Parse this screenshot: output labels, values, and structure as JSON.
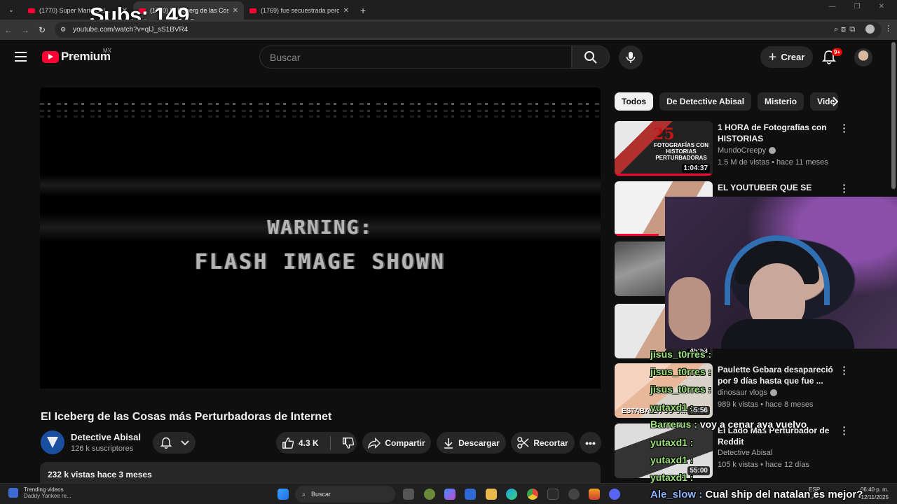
{
  "browser": {
    "tabs": [
      {
        "title": "(1770) Super Mario Gal..."
      },
      {
        "title": "(1770) El Iceberg de las Cosas má..."
      },
      {
        "title": "(1769) fue secuestrada pero la..."
      }
    ],
    "url": "youtube.com/watch?v=qlJ_sS1BVR4"
  },
  "stream_overlay": {
    "subs": "Subs: 149,"
  },
  "youtube": {
    "logo": "Premium",
    "region": "MX",
    "search_placeholder": "Buscar",
    "create_label": "Crear",
    "notif_badge": "9+"
  },
  "video": {
    "warning_line1": "WARNING:",
    "warning_line2": "FLASH IMAGE SHOWN",
    "title": "El Iceberg de las Cosas más Perturbadoras de Internet",
    "channel": "Detective Abisal",
    "subscribers": "126 k suscriptores",
    "likes": "4.3 K",
    "share": "Compartir",
    "download": "Descargar",
    "clip": "Recortar",
    "views_line": "232 k vistas  hace 3 meses"
  },
  "chips": [
    "Todos",
    "De Detective Abisal",
    "Misterio",
    "Vide"
  ],
  "recommendations": [
    {
      "title": "1 HORA de Fotografías con HISTORIAS PERTURBADORAS...",
      "channel": "MundoCreepy",
      "verified": true,
      "meta": "1.5 M de vistas • hace 11 meses",
      "duration": "1:04:37",
      "thumb_text": "25",
      "thumb_caption": "FOTOGRAFÍAS CON HISTORIAS PERTURBADORAS",
      "progress": 1.0
    },
    {
      "title": "EL YOUTUBER QUE SE",
      "channel": "",
      "verified": false,
      "meta": "",
      "duration": "",
      "progress": 0.45
    },
    {
      "title": "",
      "channel": "",
      "verified": false,
      "meta": "",
      "duration": "",
      "progress": 0
    },
    {
      "title": "",
      "channel": "",
      "verified": false,
      "meta": "",
      "duration": "45:53",
      "progress": 0
    },
    {
      "title": "Paulette Gebara desapareció por 9 días hasta que fue ...",
      "channel": "dinosaur vlogs",
      "verified": true,
      "meta": "989 k vistas • hace 8 meses",
      "duration": "55:56",
      "thumb_caption": "ESTABA EN SU C...",
      "progress": 0
    },
    {
      "title": "El Lado Más Perturbador de Reddit",
      "channel": "Detective Abisal",
      "verified": false,
      "meta": "105 k vistas • hace 12 días",
      "duration": "55:00",
      "progress": 0
    }
  ],
  "chat": [
    {
      "user": "jisus_t0rres :",
      "msg": ""
    },
    {
      "user": "jisus_t0rres :",
      "msg": ""
    },
    {
      "user": "jisus_t0rres :",
      "msg": ""
    },
    {
      "user": "yutaxd1 :",
      "msg": ""
    },
    {
      "user": "Barrerus :",
      "msg": "voy a cenar aya vuelvo"
    },
    {
      "user": "yutaxd1 :",
      "msg": ""
    },
    {
      "user": "yutaxd1 :",
      "msg": ""
    },
    {
      "user": "yutaxd1 :",
      "msg": ""
    },
    {
      "user": "Ale_slow :",
      "msg": "Cual ship del natalan es mejor?"
    }
  ],
  "taskbar": {
    "weather_title": "Trending videos",
    "weather_sub": "Daddy Yankee re...",
    "search_label": "Buscar",
    "lang": "ESP",
    "lang2": "LAA",
    "time": "06:40 p. m.",
    "date": "12/11/2025"
  }
}
